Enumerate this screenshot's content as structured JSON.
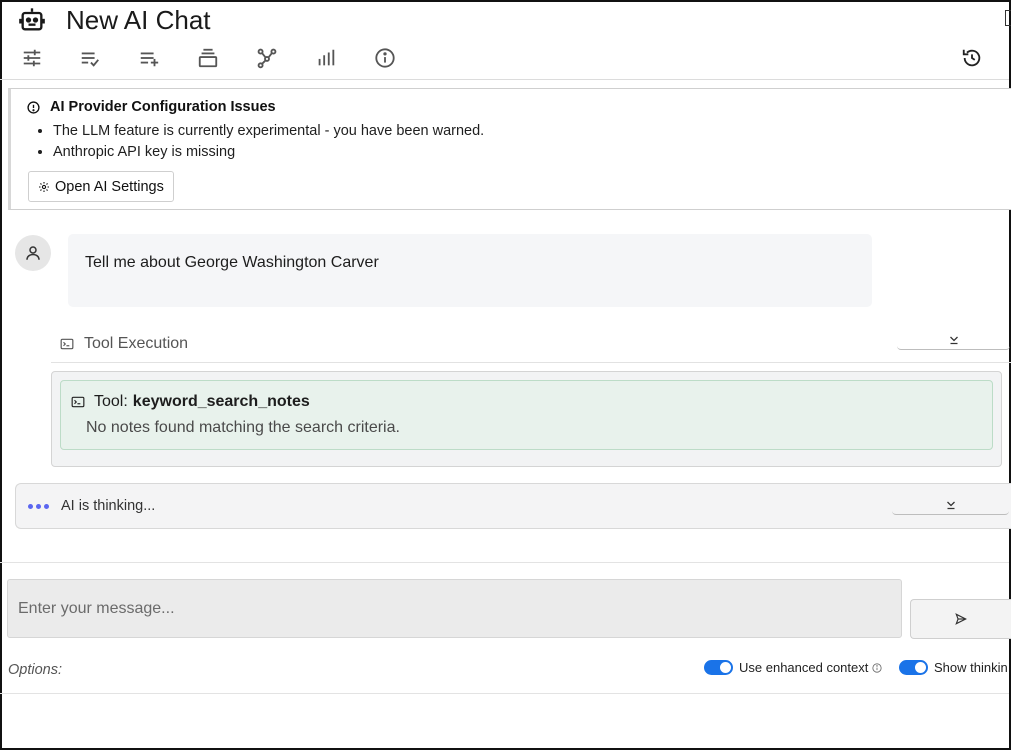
{
  "header": {
    "title": "New AI Chat",
    "robot_icon": "robot-icon"
  },
  "toolbar": {
    "buttons": [
      {
        "name": "settings-sliders-icon"
      },
      {
        "name": "list-check-icon"
      },
      {
        "name": "list-add-icon"
      },
      {
        "name": "stack-icon"
      },
      {
        "name": "graph-nodes-icon"
      },
      {
        "name": "bar-chart-icon"
      },
      {
        "name": "info-icon"
      }
    ],
    "history_icon": "history-icon"
  },
  "alert": {
    "title": "AI Provider Configuration Issues",
    "items": [
      "The LLM feature is currently experimental - you have been warned.",
      "Anthropic API key is missing"
    ],
    "button_label": "Open AI Settings"
  },
  "conversation": {
    "user_message": "Tell me about George Washington Carver",
    "tool_execution_label": "Tool Execution",
    "tool": {
      "prefix": "Tool:",
      "name": "keyword_search_notes",
      "result": "No notes found matching the search criteria."
    },
    "thinking_label": "AI is thinking..."
  },
  "composer": {
    "placeholder": "Enter your message...",
    "options_label": "Options:",
    "toggles": [
      {
        "label": "Use enhanced context",
        "on": true
      },
      {
        "label": "Show thinkin",
        "on": true
      }
    ]
  },
  "colors": {
    "accent": "#1a73e8",
    "thinking_dots": "#5b66f0",
    "tool_result_bg": "#e8f2ec"
  }
}
